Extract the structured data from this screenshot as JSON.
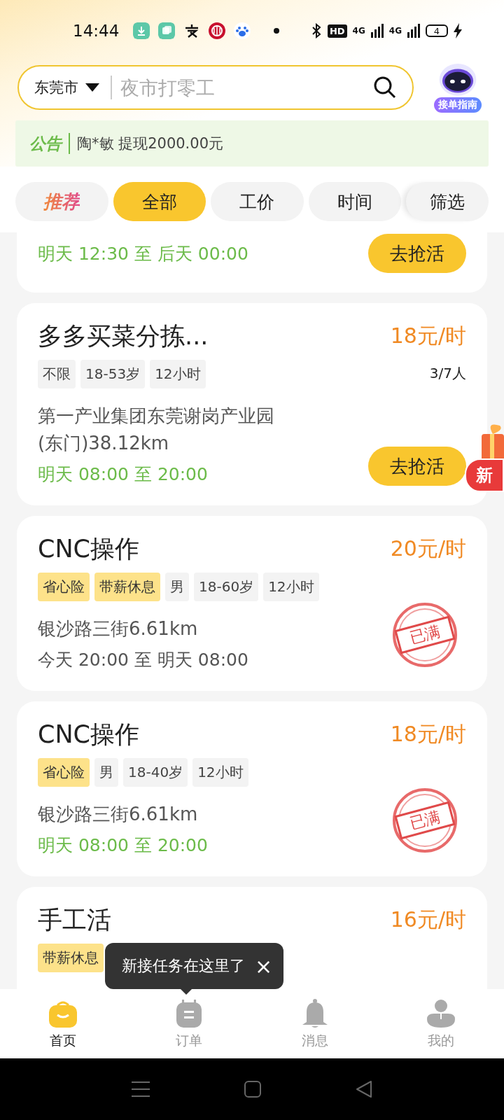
{
  "status_bar": {
    "time": "14:44",
    "hd": "HD",
    "network_1": "4G",
    "network_2": "4G",
    "battery": "4"
  },
  "search": {
    "city": "东莞市",
    "placeholder": "夜市打零工"
  },
  "guide": {
    "label": "接单指南"
  },
  "notice": {
    "label": "公告",
    "text": "陶*敏 提现2000.00元"
  },
  "filters": [
    {
      "label": "推荐",
      "kind": "featured",
      "selected": false
    },
    {
      "label": "全部",
      "kind": "chip",
      "selected": true
    },
    {
      "label": "工价",
      "kind": "chip",
      "selected": false
    },
    {
      "label": "时间",
      "kind": "chip",
      "selected": false
    },
    {
      "label": "筛选",
      "kind": "filter",
      "selected": false
    }
  ],
  "jobs": [
    {
      "kind": "partial",
      "time": "明天 12:30 至 后天 00:00",
      "time_highlighted": true,
      "action": "去抢活"
    },
    {
      "kind": "open",
      "title": "多多买菜分拣...",
      "price": "18元/时",
      "tags": [
        {
          "label": "不限",
          "kind": "plain"
        },
        {
          "label": "18-53岁",
          "kind": "plain"
        },
        {
          "label": "12小时",
          "kind": "plain"
        }
      ],
      "headcount": "3/7人",
      "address": "第一产业集团东莞谢岗产业园(东门)38.12km",
      "time": "明天 08:00 至 20:00",
      "time_highlighted": true,
      "action": "去抢活"
    },
    {
      "kind": "full",
      "title": "CNC操作",
      "price": "20元/时",
      "tags": [
        {
          "label": "省心险",
          "kind": "perk"
        },
        {
          "label": "带薪休息",
          "kind": "perk"
        },
        {
          "label": "男",
          "kind": "plain"
        },
        {
          "label": "18-60岁",
          "kind": "plain"
        },
        {
          "label": "12小时",
          "kind": "plain"
        }
      ],
      "address": "银沙路三街6.61km",
      "time": "今天 20:00 至 明天 08:00",
      "time_highlighted": false,
      "stamp": "已满"
    },
    {
      "kind": "full",
      "title": "CNC操作",
      "price": "18元/时",
      "tags": [
        {
          "label": "省心险",
          "kind": "perk"
        },
        {
          "label": "男",
          "kind": "plain"
        },
        {
          "label": "18-40岁",
          "kind": "plain"
        },
        {
          "label": "12小时",
          "kind": "plain"
        }
      ],
      "address": "银沙路三街6.61km",
      "time": "明天 08:00 至 20:00",
      "time_highlighted": true,
      "stamp": "已满"
    },
    {
      "kind": "covered",
      "title": "手工活",
      "price": "16元/时",
      "tags": [
        {
          "label": "带薪休息",
          "kind": "perk"
        }
      ]
    }
  ],
  "promo": {
    "label": "新"
  },
  "tooltip": {
    "text": "新接任务在这里了",
    "close": "×"
  },
  "tabs": [
    {
      "label": "首页",
      "kind": "home",
      "selected": true
    },
    {
      "label": "订单",
      "kind": "orders",
      "selected": false
    },
    {
      "label": "消息",
      "kind": "messages",
      "selected": false
    },
    {
      "label": "我的",
      "kind": "profile",
      "selected": false
    }
  ]
}
